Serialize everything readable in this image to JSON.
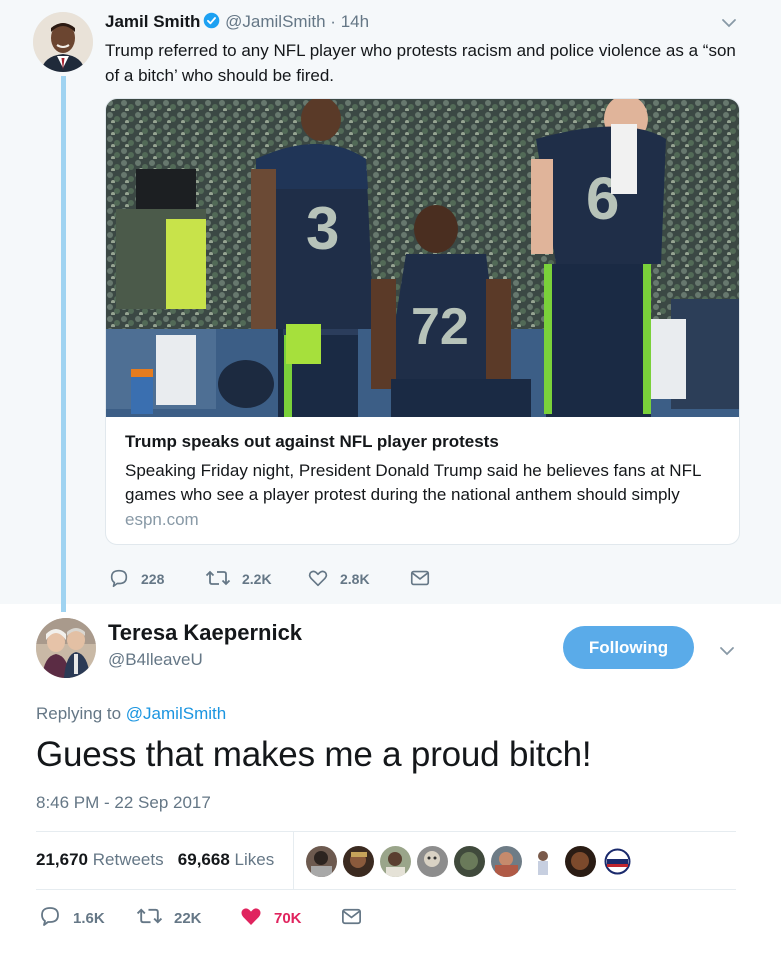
{
  "parent_tweet": {
    "author_name": "Jamil Smith",
    "author_handle": "@JamilSmith",
    "separator": "·",
    "time": "14h",
    "text": "Trump referred to any NFL player who protests racism and police violence as a “son of a bitch’ who should be fired.",
    "card": {
      "title": "Trump speaks out against NFL player protests",
      "description": "Speaking Friday night, President Donald Trump said he believes fans at NFL games who see a player protest during the national anthem should simply",
      "domain": "espn.com"
    },
    "actions": {
      "replies": "228",
      "retweets": "2.2K",
      "likes": "2.8K"
    }
  },
  "reply_tweet": {
    "author_name": "Teresa Kaepernick",
    "author_handle": "@B4lleaveU",
    "follow_label": "Following",
    "replying_prefix": "Replying to",
    "replying_to": "@JamilSmith",
    "text": "Guess that makes me a proud bitch!",
    "timestamp": "8:46 PM - 22 Sep 2017",
    "stats": {
      "retweets_count": "21,670",
      "retweets_label": "Retweets",
      "likes_count": "69,668",
      "likes_label": "Likes"
    },
    "actions": {
      "replies": "1.6K",
      "retweets": "22K",
      "likes": "70K"
    }
  },
  "colors": {
    "accent": "#1b95e0",
    "follow_button": "#5aabe9",
    "liked_heart": "#e0245e",
    "thread_line": "#9fd3f1",
    "muted_text": "#657786"
  },
  "icons": {
    "verified": "verified-badge-icon",
    "chevron": "chevron-down-icon",
    "reply": "reply-bubble-icon",
    "retweet": "retweet-arrows-icon",
    "like": "heart-icon",
    "dm": "envelope-icon"
  }
}
